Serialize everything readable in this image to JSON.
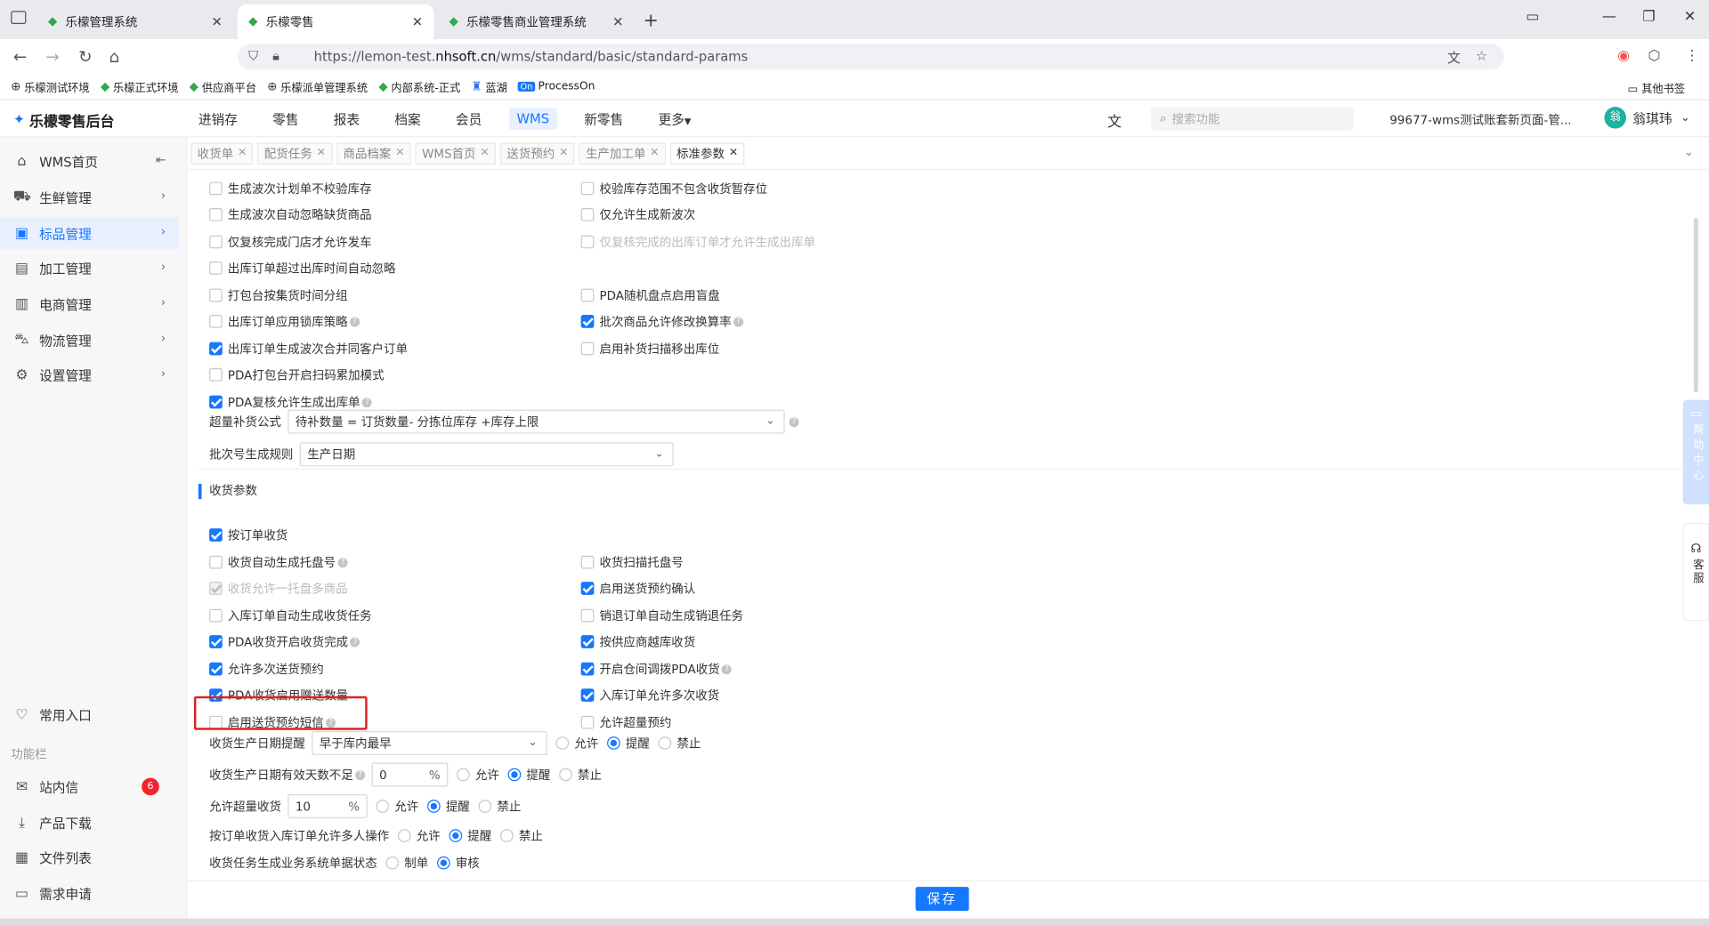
{
  "browser": {
    "tabs": [
      {
        "label": "乐檬管理系统"
      },
      {
        "label": "乐檬零售"
      },
      {
        "label": "乐檬零售商业管理系统"
      }
    ],
    "url_prefix": "https://lemon-test.",
    "url_domain": "nhsoft.cn",
    "url_path": "/wms/standard/basic/standard-params",
    "bookmarks": [
      "乐檬测试环境",
      "乐檬正式环境",
      "供应商平台",
      "乐檬派单管理系统",
      "内部系统-正式",
      "蓝湖",
      "ProcessOn"
    ],
    "other_bookmarks": "其他书签"
  },
  "header": {
    "logo": "乐檬零售后台",
    "menu": [
      "进销存",
      "零售",
      "报表",
      "档案",
      "会员",
      "WMS",
      "新零售",
      "更多"
    ],
    "search_placeholder": "搜索功能",
    "account": "99677-wms测试账套新页面-管...",
    "user": "翁琪玮",
    "user_avatar": "翁"
  },
  "sidebar": {
    "items": [
      {
        "label": "WMS首页",
        "icon": "home-icon"
      },
      {
        "label": "生鲜管理",
        "icon": "fresh-icon"
      },
      {
        "label": "标品管理",
        "icon": "box-icon"
      },
      {
        "label": "加工管理",
        "icon": "process-icon"
      },
      {
        "label": "电商管理",
        "icon": "shop-icon"
      },
      {
        "label": "物流管理",
        "icon": "truck-icon"
      },
      {
        "label": "设置管理",
        "icon": "gear-icon"
      }
    ],
    "common": "常用入口",
    "func_label": "功能栏",
    "func_items": [
      {
        "label": "站内信",
        "badge": "6"
      },
      {
        "label": "产品下载"
      },
      {
        "label": "文件列表"
      },
      {
        "label": "需求申请"
      }
    ]
  },
  "page_tabs": [
    "收货单",
    "配货任务",
    "商品档案",
    "WMS首页",
    "送货预约",
    "生产加工单",
    "标准参数"
  ],
  "params_top": [
    {
      "label": "生成波次计划单不校验库存",
      "checked": false
    },
    {
      "label": "校验库存范围不包含收货暂存位",
      "checked": false
    },
    {
      "label": "生成波次自动忽略缺货商品",
      "checked": false
    },
    {
      "label": "仅允许生成新波次",
      "checked": false
    },
    {
      "label": "仅复核完成门店才允许发车",
      "checked": false
    },
    {
      "label": "仅复核完成的出库订单才允许生成出库单",
      "checked": false,
      "disabled": true
    },
    {
      "label": "出库订单超过出库时间自动忽略",
      "checked": false
    },
    {
      "label": "打包台按集货时间分组",
      "checked": false
    },
    {
      "label": "PDA随机盘点启用盲盘",
      "checked": false
    },
    {
      "label": "出库订单应用锁库策略",
      "checked": false,
      "help": true
    },
    {
      "label": "批次商品允许修改换算率",
      "checked": true,
      "help": true
    },
    {
      "label": "出库订单生成波次合并同客户订单",
      "checked": true
    },
    {
      "label": "启用补货扫描移出库位",
      "checked": false
    },
    {
      "label": "PDA打包台开启扫码累加模式",
      "checked": false
    },
    {
      "label": "PDA复核允许生成出库单",
      "checked": true,
      "help": true
    }
  ],
  "replenish_formula": {
    "label": "超量补货公式",
    "value": "待补数量 = 订货数量- 分拣位库存 +库存上限"
  },
  "batch_rule": {
    "label": "批次号生成规则",
    "value": "生产日期"
  },
  "receive_section": "收货参数",
  "params_receive": [
    {
      "label": "按订单收货",
      "checked": true
    },
    {
      "label": "收货自动生成托盘号",
      "checked": false,
      "help": true
    },
    {
      "label": "收货扫描托盘号",
      "checked": false
    },
    {
      "label": "收货允许一托盘多商品",
      "checked": true,
      "disabled": true
    },
    {
      "label": "启用送货预约确认",
      "checked": true
    },
    {
      "label": "入库订单自动生成收货任务",
      "checked": false
    },
    {
      "label": "销退订单自动生成销退任务",
      "checked": false
    },
    {
      "label": "PDA收货开启收货完成",
      "checked": true,
      "help": true
    },
    {
      "label": "按供应商越库收货",
      "checked": true
    },
    {
      "label": "允许多次送货预约",
      "checked": true
    },
    {
      "label": "开启仓间调拨PDA收货",
      "checked": true,
      "help": true
    },
    {
      "label": "PDA收货启用赠送数量",
      "checked": true
    },
    {
      "label": "入库订单允许多次收货",
      "checked": true
    },
    {
      "label": "启用送货预约短信",
      "checked": false,
      "help": true
    },
    {
      "label": "允许超量预约",
      "checked": false
    }
  ],
  "radio_labels": {
    "allow": "允许",
    "remind": "提醒",
    "forbid": "禁止",
    "draft": "制单",
    "audit": "审核"
  },
  "prod_date_remind": {
    "label": "收货生产日期提醒",
    "select": "早于库内最早",
    "value": "提醒"
  },
  "valid_days": {
    "label": "收货生产日期有效天数不足",
    "input": "0",
    "unit": "%",
    "value": "提醒"
  },
  "over_receive": {
    "label": "允许超量收货",
    "input": "10",
    "unit": "%",
    "value": "提醒"
  },
  "multi_user": {
    "label": "按订单收货入库订单允许多人操作",
    "value": "提醒"
  },
  "task_status": {
    "label": "收货任务生成业务系统单据状态",
    "value": "审核"
  },
  "footer": {
    "save": "保存"
  },
  "float": {
    "help": "帮助中心",
    "kefu": "客服"
  },
  "colors": {
    "primary": "#1677ff",
    "highlight": "#e02020"
  }
}
